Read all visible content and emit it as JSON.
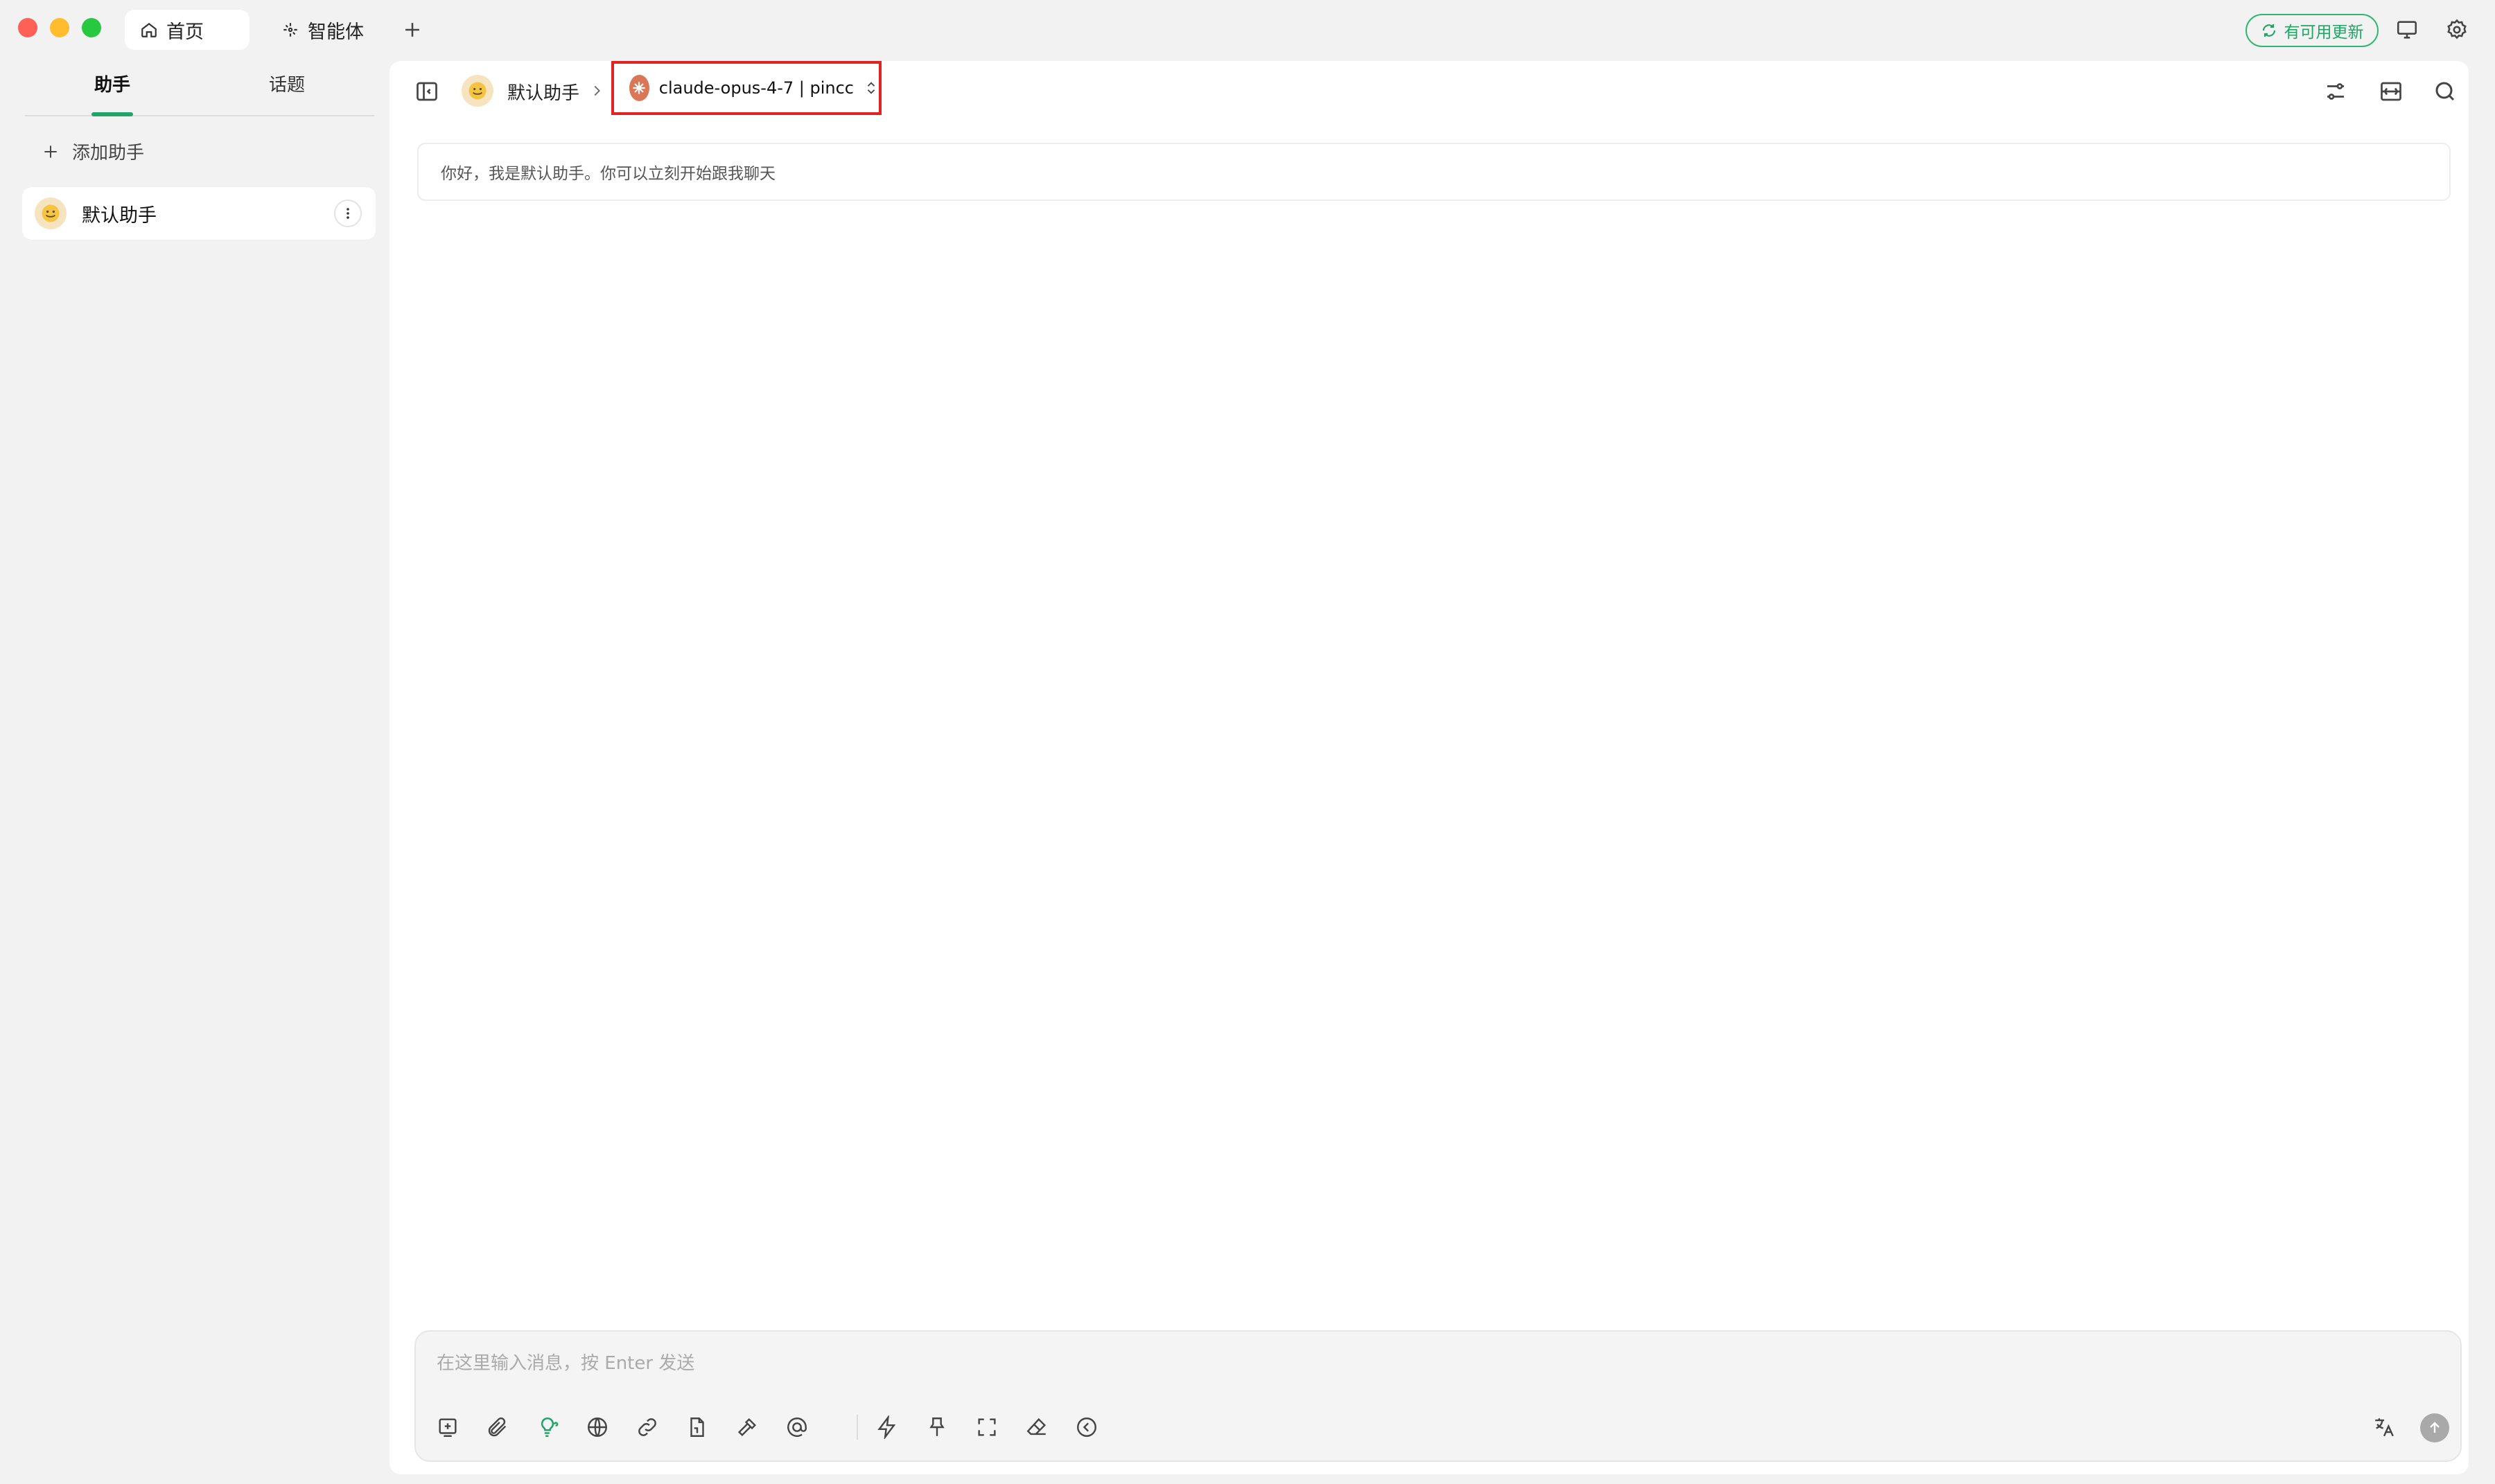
{
  "window": {
    "tabs": [
      {
        "label": "首页",
        "icon": "home-icon"
      },
      {
        "label": "智能体",
        "icon": "sparkle-icon"
      }
    ],
    "update_label": "有可用更新",
    "icons": [
      "add-tab-icon",
      "refresh-icon",
      "monitor-icon",
      "gear-icon"
    ]
  },
  "sidebar": {
    "tabs": [
      "助手",
      "话题"
    ],
    "active_tab": "助手",
    "add_label": "添加助手",
    "assistants": [
      {
        "name": "默认助手",
        "icon": "smiley-icon"
      }
    ]
  },
  "main": {
    "breadcrumb_assistant": "默认助手",
    "model_label": "claude-opus-4-7 | pincc",
    "greeting": "你好，我是默认助手。你可以立刻开始跟我聊天",
    "input_placeholder": "在这里输入消息，按 Enter 发送",
    "header_icons": [
      "sidebar-toggle-icon",
      "settings-sliders-icon",
      "layout-icon",
      "search-icon"
    ],
    "toolbar_icons": [
      "new-topic-icon",
      "attachment-icon",
      "thinking-icon",
      "web-search-icon",
      "link-icon",
      "knowledge-icon",
      "tools-icon",
      "mention-icon",
      "quick-phrase-icon",
      "pin-icon",
      "fullscreen-icon",
      "clear-icon",
      "collapse-icon"
    ],
    "right_icons": [
      "translate-icon",
      "send-icon"
    ]
  },
  "colors": {
    "accent": "#1fa56b",
    "highlight_box": "#e02424",
    "model_logo": "#d97757"
  }
}
